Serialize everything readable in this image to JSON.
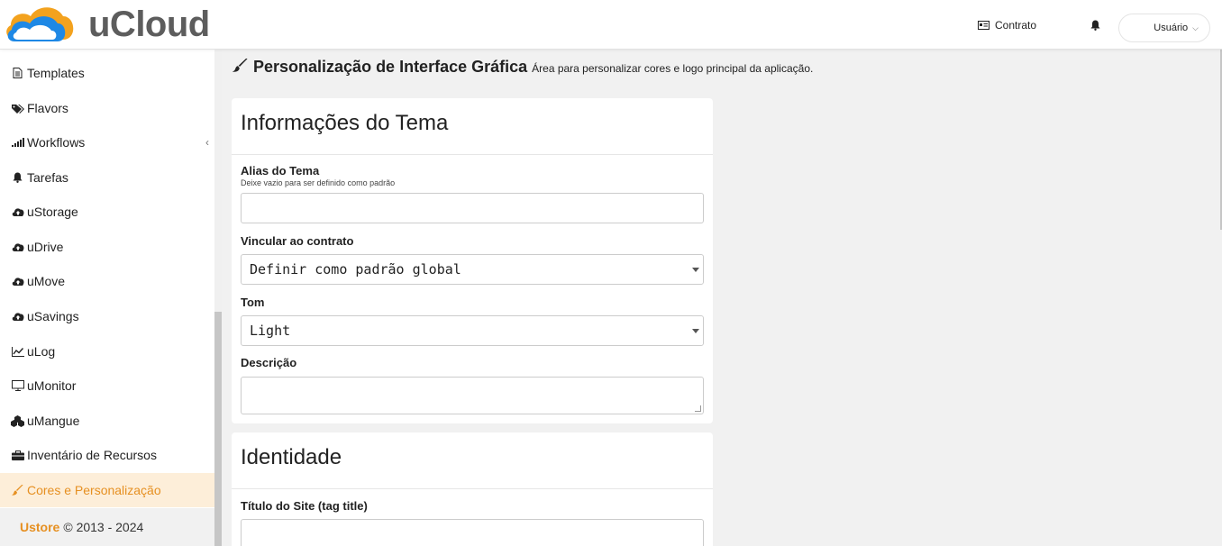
{
  "app": {
    "brand": "uCloud",
    "logo_icon": "cloud-logo-icon",
    "accent": "#e69022"
  },
  "topbar": {
    "contract_label": "Contrato",
    "contract_icon": "id-card-icon",
    "bell_icon": "bell-icon",
    "user_label": "Usuário",
    "user_chevron": "⌵"
  },
  "sidebar": {
    "items": [
      {
        "label": "Templates",
        "icon": "file-icon",
        "glyph": "▤"
      },
      {
        "label": "Flavors",
        "icon": "tags-icon",
        "glyph": "⬖"
      },
      {
        "label": "Workflows",
        "icon": "signal-icon",
        "glyph": "▁▂▃"
      },
      {
        "label": "Tarefas",
        "icon": "bell-icon",
        "glyph": "🔔"
      },
      {
        "label": "uStorage",
        "icon": "cloud-upload-icon",
        "glyph": "☁"
      },
      {
        "label": "uDrive",
        "icon": "cloud-upload-icon",
        "glyph": "☁"
      },
      {
        "label": "uMove",
        "icon": "cloud-upload-icon",
        "glyph": "☁"
      },
      {
        "label": "uSavings",
        "icon": "cloud-upload-icon",
        "glyph": "☁"
      },
      {
        "label": "uLog",
        "icon": "line-chart-icon",
        "glyph": "⟋"
      },
      {
        "label": "uMonitor",
        "icon": "monitor-icon",
        "glyph": "▭"
      },
      {
        "label": "uMangue",
        "icon": "cubes-icon",
        "glyph": "⬢"
      },
      {
        "label": "Inventário de Recursos",
        "icon": "briefcase-icon",
        "glyph": "▬"
      },
      {
        "label": "Cores e Personalização",
        "icon": "paint-brush-icon",
        "glyph": "🖌"
      }
    ],
    "workflows_arrow": "‹",
    "footer": {
      "brand": "Ustore",
      "copyright": "© 2013 - 2024"
    }
  },
  "page": {
    "title": "Personalização de Interface Gráfica",
    "subtitle": "Área para personalizar cores e logo principal da aplicação.",
    "icon": "paint-brush-icon"
  },
  "theme_card": {
    "title": "Informações do Tema",
    "alias_label": "Alias do Tema",
    "alias_hint": "Deixe vazio para ser definido como padrão",
    "alias_value": "",
    "contract_label": "Vincular ao contrato",
    "contract_value": "Definir como padrão global",
    "tone_label": "Tom",
    "tone_value": "Light",
    "description_label": "Descrição",
    "description_value": ""
  },
  "identity_card": {
    "title": "Identidade",
    "site_title_label": "Título do Site (tag title)",
    "site_title_value": ""
  }
}
